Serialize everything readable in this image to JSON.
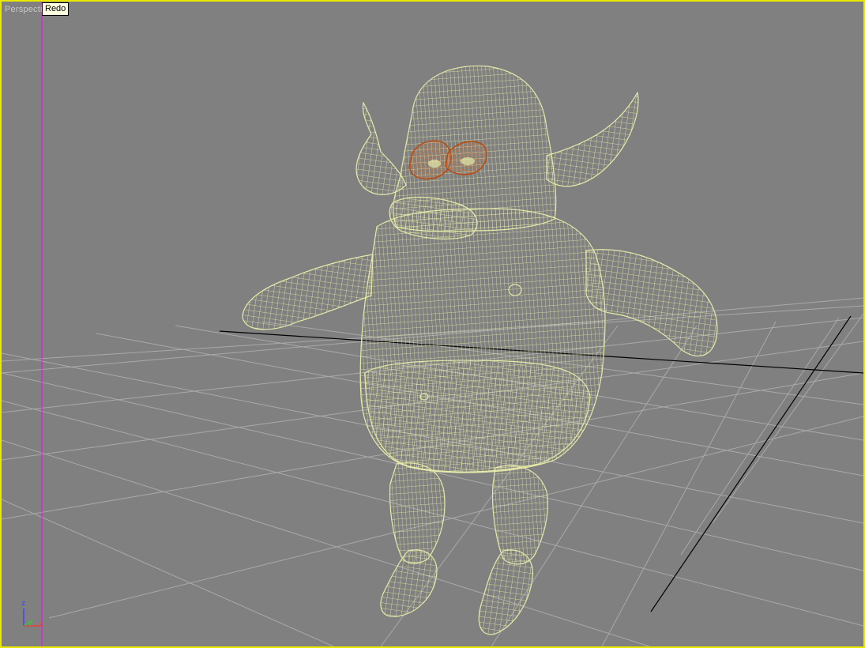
{
  "viewport": {
    "label": "Perspective",
    "border_color": "#e8e800",
    "background": "#808080"
  },
  "tooltip": {
    "text": "Redo"
  },
  "model": {
    "wire_color": "#e6eaa8",
    "eye_color": "#b84a12",
    "eye_fill": "#8a3208"
  },
  "grid": {
    "line_color": "#a8a8a8",
    "main_axis_color": "#000000"
  },
  "gizmo": {
    "z_label": "z",
    "y_label": "y",
    "x_label": "x",
    "z_color": "#3838ff",
    "y_color": "#38c838",
    "x_color": "#ff3030"
  },
  "icons": [
    "axis-gizmo-icon"
  ]
}
